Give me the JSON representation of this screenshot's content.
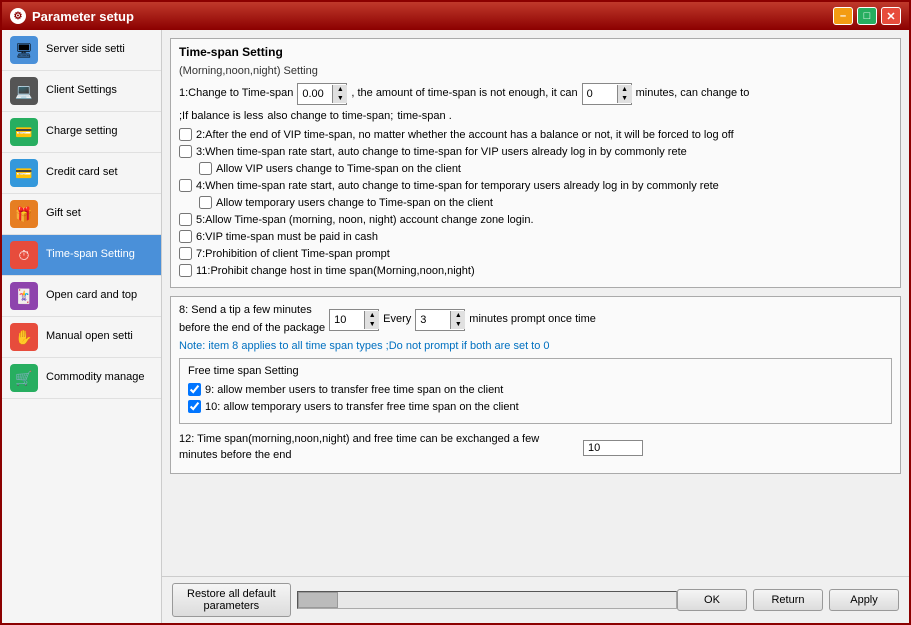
{
  "window": {
    "title": "Parameter setup",
    "icon": "⚙"
  },
  "titleControls": {
    "minimize": "–",
    "maximize": "□",
    "close": "✕"
  },
  "sidebar": {
    "items": [
      {
        "id": "server-side",
        "label": "Server side setti",
        "icon": "🖥",
        "iconBg": "#4a90d9",
        "active": false
      },
      {
        "id": "client-settings",
        "label": "Client Settings",
        "icon": "💻",
        "iconBg": "#555",
        "active": false
      },
      {
        "id": "charge-setting",
        "label": "Charge setting",
        "icon": "💳",
        "iconBg": "#27ae60",
        "active": false
      },
      {
        "id": "credit-card",
        "label": "Credit card set",
        "icon": "💳",
        "iconBg": "#3498db",
        "active": false
      },
      {
        "id": "gift-set",
        "label": "Gift set",
        "icon": "🎁",
        "iconBg": "#e67e22",
        "active": false
      },
      {
        "id": "time-span",
        "label": "Time-span Setting",
        "icon": "⏱",
        "iconBg": "#e74c3c",
        "active": true
      },
      {
        "id": "open-card",
        "label": "Open card and top",
        "icon": "🃏",
        "iconBg": "#8e44ad",
        "active": false
      },
      {
        "id": "manual-open",
        "label": "Manual open setti",
        "icon": "✋",
        "iconBg": "#e74c3c",
        "active": false
      },
      {
        "id": "commodity",
        "label": "Commodity manage",
        "icon": "🛒",
        "iconBg": "#27ae60",
        "active": false
      }
    ]
  },
  "content": {
    "sectionTitle": "Time-span Setting",
    "morningNoonNight": "(Morning,noon,night) Setting",
    "row1": {
      "label1": "1:Change to Time-span",
      "spinValue1": "0.00",
      "label2": ", the amount of time-span is not enough, it can",
      "spinValue2": "0",
      "label3": "minutes, can change to",
      "label4": "time-span .",
      "label5": ";If balance is less",
      "label6": "also change to time-span;"
    },
    "check2": {
      "checked": false,
      "label": "2:After the end of VIP time-span, no matter whether the account has a balance or not, it will be forced to log off"
    },
    "check3": {
      "checked": false,
      "label": "3:When time-span rate start, auto change to time-span for VIP users already log in by commonly rete"
    },
    "checkAllowVIP": {
      "checked": false,
      "label": "Allow VIP users change to Time-span on the client"
    },
    "check4": {
      "checked": false,
      "label": "4:When time-span rate start, auto change to time-span for temporary users already log in by commonly rete"
    },
    "checkAllowTemp": {
      "checked": false,
      "label": "Allow temporary users change to Time-span on the client"
    },
    "check5": {
      "checked": false,
      "label": "5:Allow Time-span (morning, noon, night) account change zone login."
    },
    "check6": {
      "checked": false,
      "label": "6:VIP time-span must be paid in cash"
    },
    "check7": {
      "checked": false,
      "label": "7:Prohibition of client Time-span prompt"
    },
    "check11": {
      "checked": false,
      "label": "11:Prohibit change host in time span(Morning,noon,night)"
    },
    "tip8": {
      "label1": "8: Send a tip a few minutes",
      "spinValue1": "10",
      "label2": "Every",
      "spinValue2": "3",
      "label3": "minutes prompt once time",
      "label4": "before the end of the package"
    },
    "note": "Note: item 8 applies to all time span  types ;Do not prompt if both are set to 0",
    "freeTimeSection": {
      "title": "Free time span Setting",
      "check9": {
        "checked": true,
        "label": "9: allow member users to transfer free time span on the client"
      },
      "check10": {
        "checked": true,
        "label": "10: allow temporary users to transfer free time span on the client"
      }
    },
    "item12": {
      "label": "12: Time span(morning,noon,night) and free time can be exchanged a few minutes before the end",
      "value": "10"
    }
  },
  "bottomBar": {
    "restoreBtn": "Restore all default\nparameters",
    "okBtn": "OK",
    "returnBtn": "Return",
    "applyBtn": "Apply"
  }
}
